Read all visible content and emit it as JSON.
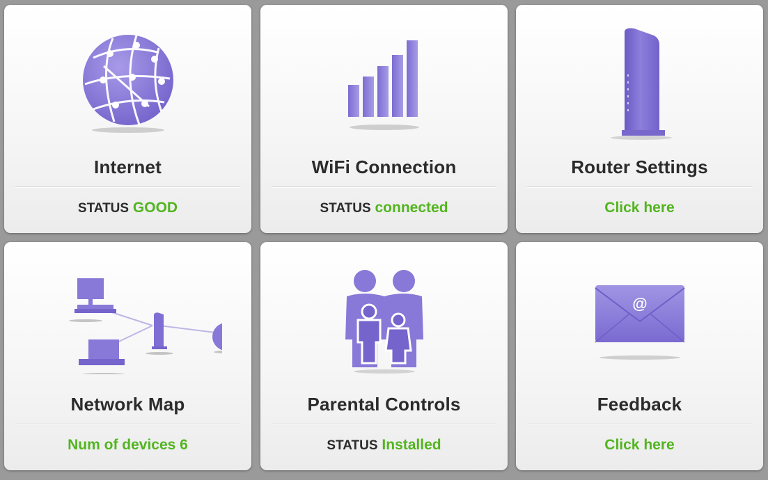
{
  "colors": {
    "background": "#9a9a9a",
    "tile": "#f6f6f6",
    "icon_purple": "#8878d8",
    "status_green": "#52b51f",
    "title_text": "#2b2b2b"
  },
  "tiles": [
    {
      "title": "Internet",
      "status_prefix": "STATUS",
      "status_value": "GOOD",
      "icon": "globe-icon"
    },
    {
      "title": "WiFi Connection",
      "status_prefix": "STATUS",
      "status_value": "connected",
      "icon": "signal-bars-icon"
    },
    {
      "title": "Router Settings",
      "link": "Click here",
      "icon": "router-icon"
    },
    {
      "title": "Network Map",
      "link": "Num of devices 6",
      "icon": "network-map-icon"
    },
    {
      "title": "Parental Controls",
      "status_prefix": "STATUS",
      "status_value": "Installed",
      "icon": "family-icon"
    },
    {
      "title": "Feedback",
      "link": "Click here",
      "icon": "envelope-icon"
    }
  ]
}
